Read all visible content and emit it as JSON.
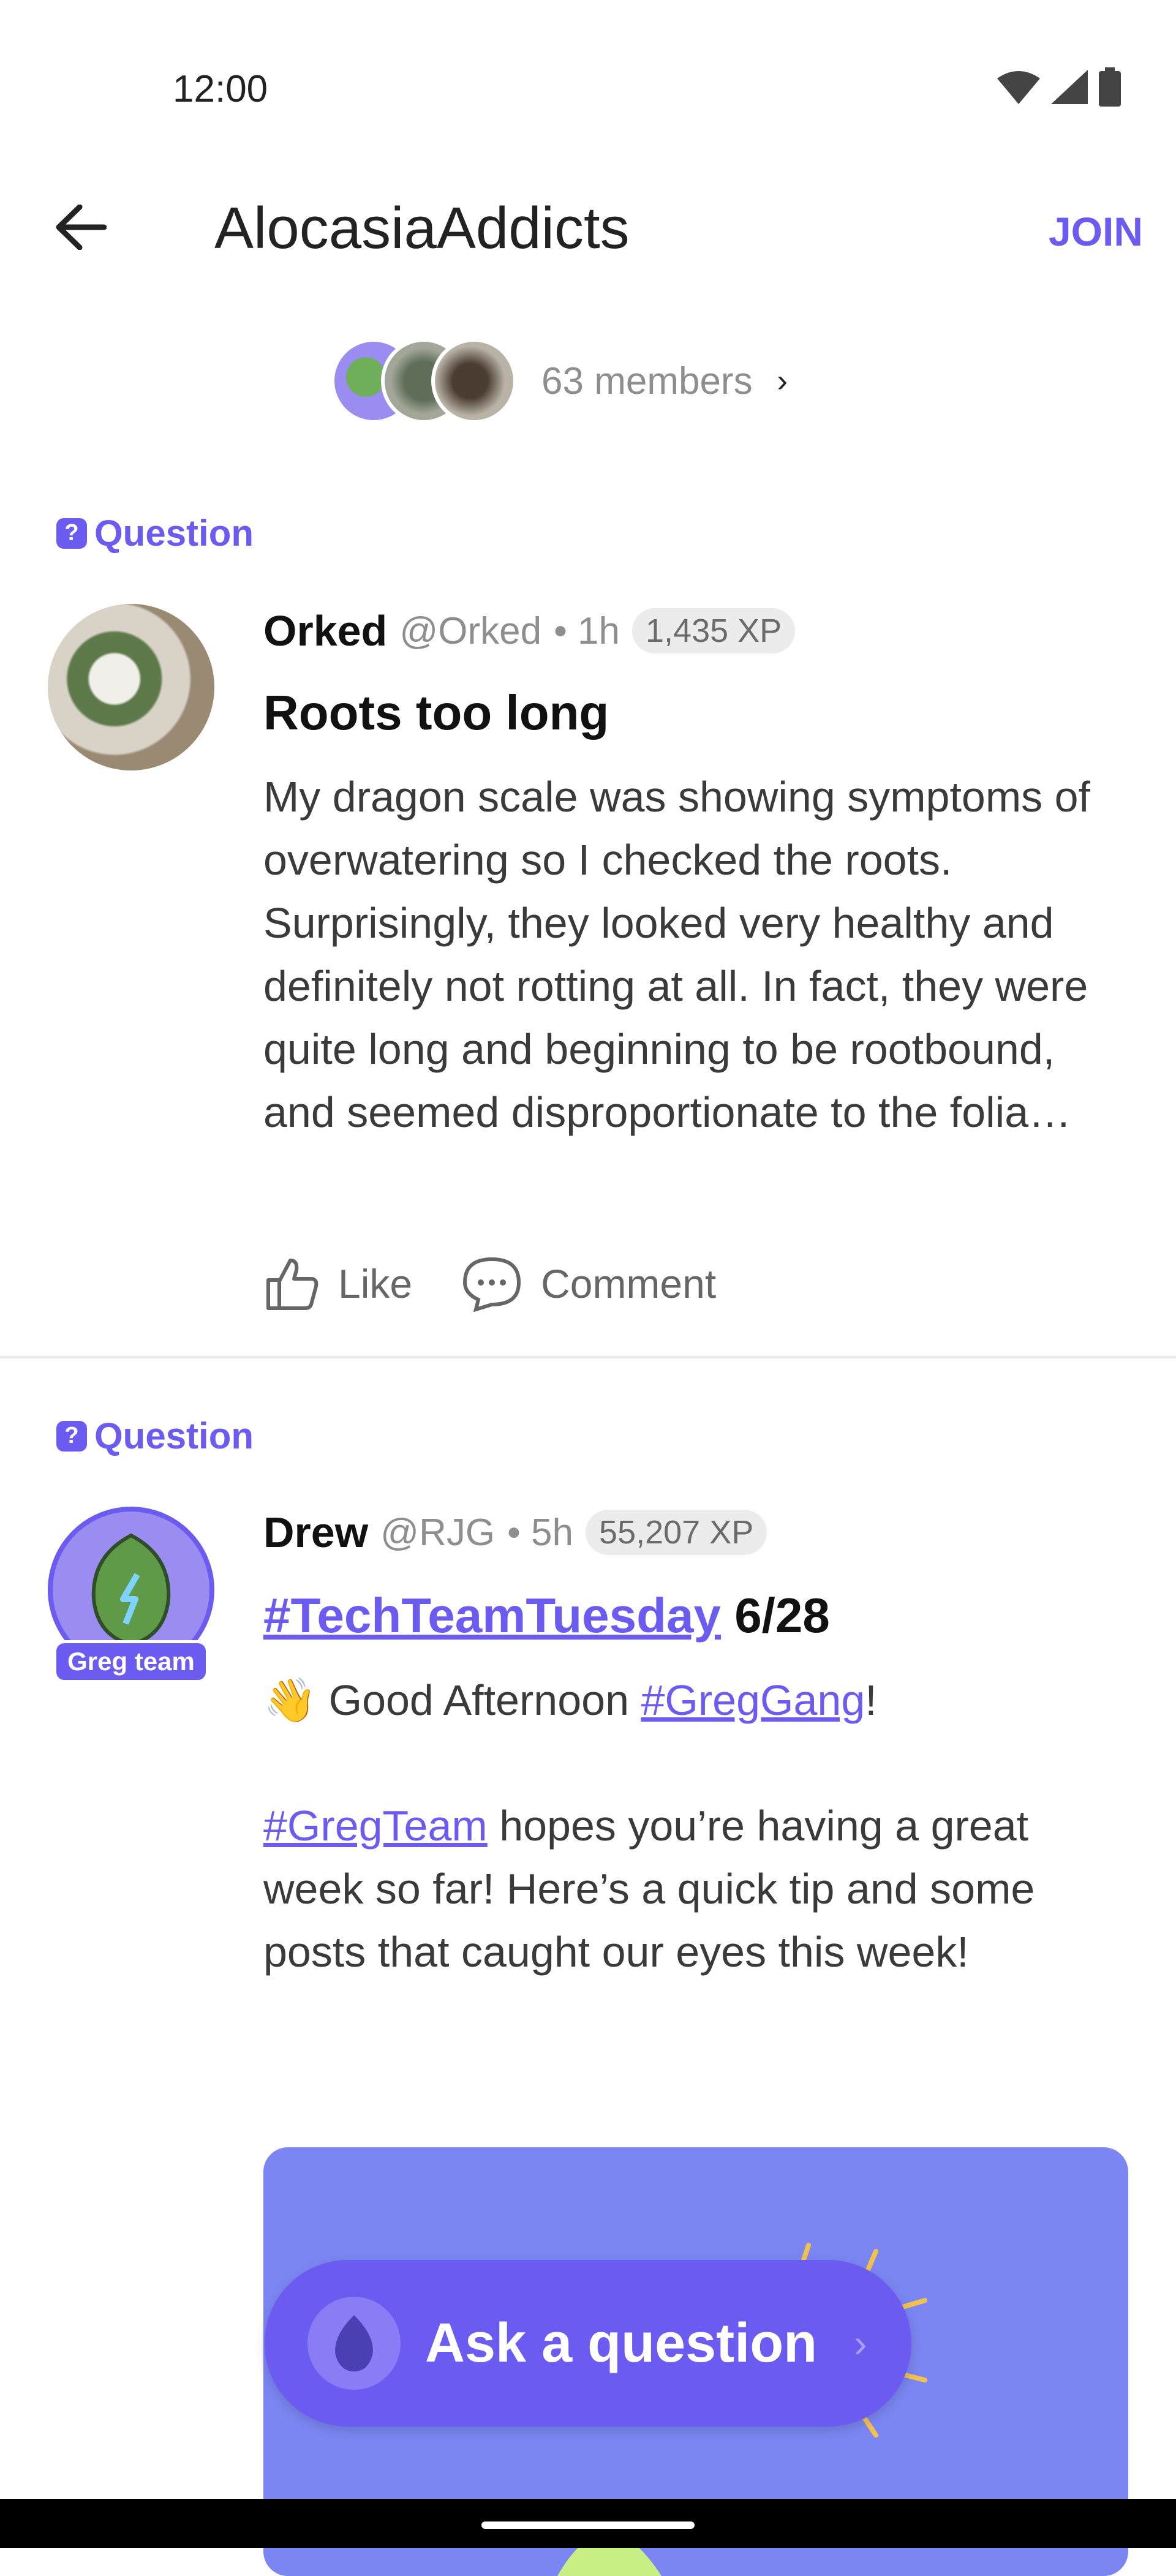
{
  "status": {
    "time": "12:00"
  },
  "header": {
    "title": "AlocasiaAddicts",
    "join_label": "JOIN"
  },
  "members": {
    "count_label": "63 members"
  },
  "posts": [
    {
      "tag": "Question",
      "author": "Orked",
      "handle": "@Orked",
      "time": "• 1h",
      "xp": "1,435 XP",
      "title": "Roots too long",
      "body": "My dragon scale was showing symptoms of overwatering so I checked the roots. Surprisingly, they looked very healthy and definitely not rotting at all. In fact, they were quite long and beginning to be rootbound, and seemed disproportionate to the folia…",
      "like_label": "Like",
      "comment_label": "Comment"
    },
    {
      "tag": "Question",
      "author": "Drew",
      "handle": "@RJG",
      "time": "• 5h",
      "xp": "55,207 XP",
      "badge": "Greg team",
      "title_link": "#TechTeamTuesday",
      "title_rest": "6/28",
      "line1_emoji": "👋",
      "line1_text": "Good Afternoon",
      "line1_link": "#GregGang",
      "line1_end": "!",
      "line2_link": "#GregTeam",
      "line2_text": "hopes you’re having a great week so far! Here’s a quick tip and some posts that caught our eyes this week!"
    }
  ],
  "ask": {
    "label": "Ask a question"
  },
  "colors": {
    "accent": "#6b5bf0",
    "card": "#7b86f2"
  }
}
